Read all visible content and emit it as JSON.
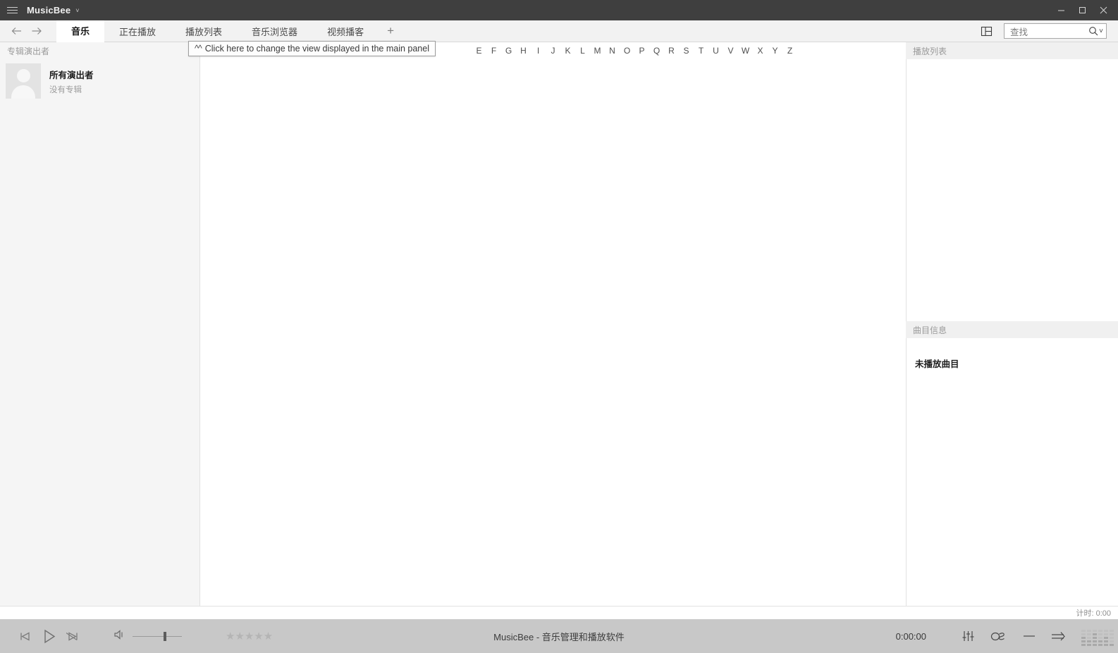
{
  "window": {
    "app_name": "MusicBee",
    "menu_icon": "hamburger-icon",
    "dropdown_caret": "˅",
    "controls": {
      "minimize": "minimize-icon",
      "maximize": "maximize-icon",
      "close": "close-icon"
    }
  },
  "tabbar": {
    "back": "back-arrow-icon",
    "forward": "forward-arrow-icon",
    "tabs": [
      {
        "label": "音乐",
        "active": true
      },
      {
        "label": "正在播放",
        "active": false
      },
      {
        "label": "播放列表",
        "active": false
      },
      {
        "label": "音乐浏览器",
        "active": false
      },
      {
        "label": "视频播客",
        "active": false
      }
    ],
    "add_tab": "+",
    "panel_layout_icon": "panel-layout-icon",
    "search": {
      "placeholder": "查找",
      "value": "",
      "icon": "search-icon",
      "caret": "˅"
    }
  },
  "tooltip": {
    "carets": "^^",
    "text": "Click here to change the view displayed in the main panel"
  },
  "sidebar": {
    "header": "专辑演出者",
    "items": [
      {
        "name": "所有演出者",
        "sub": "没有专辑",
        "avatar": "person-avatar-icon"
      }
    ]
  },
  "main_panel": {
    "alphabet": [
      "E",
      "F",
      "G",
      "H",
      "I",
      "J",
      "K",
      "L",
      "M",
      "N",
      "O",
      "P",
      "Q",
      "R",
      "S",
      "T",
      "U",
      "V",
      "W",
      "X",
      "Y",
      "Z"
    ],
    "content": ""
  },
  "right_panel": {
    "playlist_header": "播放列表",
    "playlist_items": [],
    "trackinfo_header": "曲目信息",
    "trackinfo_text": "未播放曲目"
  },
  "statusbar": {
    "timer": "计时: 0:00"
  },
  "player": {
    "prev": "previous-track-icon",
    "play": "play-icon",
    "next": "next-track-icon",
    "volume_icon": "volume-icon",
    "volume_percent": 63,
    "rating_stars": "★★★★★",
    "rating_value": 0,
    "now_playing": "MusicBee - 音乐管理和播放软件",
    "elapsed": "0:00:00",
    "equalizer_icon": "equalizer-icon",
    "scrobble_icon": "lastfm-scrobble-icon",
    "minus_icon": "dash-icon",
    "repeat_icon": "repeat-arrow-icon",
    "visualizer_icon": "spectrum-visualizer-icon"
  },
  "colors": {
    "titlebar": "#3f3f3f",
    "tabbar": "#f2f2f2",
    "sidebar": "#f5f5f5",
    "panel_head": "#f0f0f0",
    "player": "#c8c8c8",
    "content": "#ffffff"
  }
}
